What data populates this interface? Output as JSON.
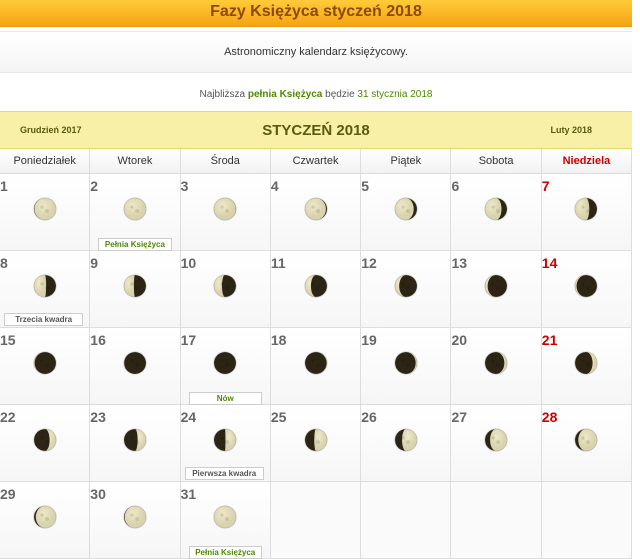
{
  "header": {
    "title": "Fazy Księżyca styczeń 2018"
  },
  "subtitle": "Astronomiczny kalendarz księżycowy.",
  "next_full": {
    "prefix": "Najbliższa",
    "highlight": "pełnia Księżyca",
    "middle": "będzie",
    "date": "31 stycznia 2018"
  },
  "month_nav": {
    "prev": "Grudzień 2017",
    "current": "STYCZEŃ 2018",
    "next": "Luty 2018"
  },
  "weekdays": [
    "Poniedziałek",
    "Wtorek",
    "Środa",
    "Czwartek",
    "Piątek",
    "Sobota",
    "Niedziela"
  ],
  "calendar": [
    {
      "day": "1",
      "illum": 0.98,
      "side": "right"
    },
    {
      "day": "2",
      "illum": 1.0,
      "side": "right",
      "event": "Pełnia Księżyca"
    },
    {
      "day": "3",
      "illum": 0.99,
      "side": "left"
    },
    {
      "day": "4",
      "illum": 0.95,
      "side": "left"
    },
    {
      "day": "5",
      "illum": 0.85,
      "side": "left"
    },
    {
      "day": "6",
      "illum": 0.75,
      "side": "left"
    },
    {
      "day": "7",
      "illum": 0.65,
      "side": "left",
      "sunday": true
    },
    {
      "day": "8",
      "illum": 0.55,
      "side": "left",
      "event": "Trzecia kwadra"
    },
    {
      "day": "9",
      "illum": 0.45,
      "side": "left"
    },
    {
      "day": "10",
      "illum": 0.36,
      "side": "left"
    },
    {
      "day": "11",
      "illum": 0.27,
      "side": "left"
    },
    {
      "day": "12",
      "illum": 0.19,
      "side": "left"
    },
    {
      "day": "13",
      "illum": 0.12,
      "side": "left"
    },
    {
      "day": "14",
      "illum": 0.07,
      "side": "left",
      "sunday": true
    },
    {
      "day": "15",
      "illum": 0.03,
      "side": "left"
    },
    {
      "day": "16",
      "illum": 0.01,
      "side": "left"
    },
    {
      "day": "17",
      "illum": 0.0,
      "side": "right",
      "event": "Nów"
    },
    {
      "day": "18",
      "illum": 0.02,
      "side": "right"
    },
    {
      "day": "19",
      "illum": 0.06,
      "side": "right"
    },
    {
      "day": "20",
      "illum": 0.12,
      "side": "right"
    },
    {
      "day": "21",
      "illum": 0.2,
      "side": "right",
      "sunday": true
    },
    {
      "day": "22",
      "illum": 0.29,
      "side": "right"
    },
    {
      "day": "23",
      "illum": 0.38,
      "side": "right"
    },
    {
      "day": "24",
      "illum": 0.48,
      "side": "right",
      "event": "Pierwsza kwadra"
    },
    {
      "day": "25",
      "illum": 0.58,
      "side": "right"
    },
    {
      "day": "26",
      "illum": 0.68,
      "side": "right"
    },
    {
      "day": "27",
      "illum": 0.77,
      "side": "right"
    },
    {
      "day": "28",
      "illum": 0.85,
      "side": "right",
      "sunday": true
    },
    {
      "day": "29",
      "illum": 0.92,
      "side": "right"
    },
    {
      "day": "30",
      "illum": 0.97,
      "side": "right"
    },
    {
      "day": "31",
      "illum": 1.0,
      "side": "right",
      "event": "Pełnia Księżyca"
    }
  ],
  "colors": {
    "lit": "#d8d2ad",
    "dark": "#2c2515",
    "sunday": "#cc0000",
    "accent": "#4b8a00"
  }
}
